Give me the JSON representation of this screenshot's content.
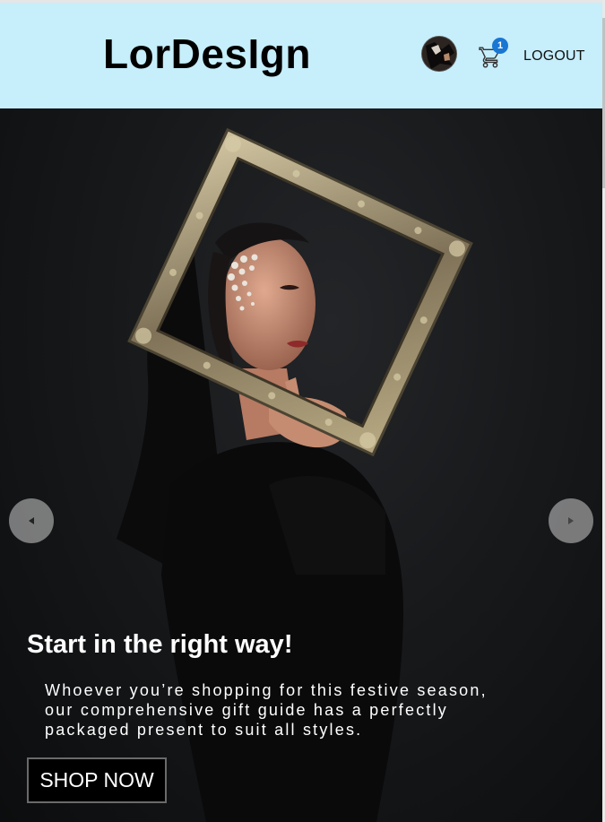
{
  "header": {
    "brand": "LorDesIgn",
    "avatar_icon": "user-avatar",
    "cart_icon": "shopping-cart-icon",
    "cart_count": "1",
    "logout_label": "LOGOUT"
  },
  "hero": {
    "title": "Start in the right way!",
    "description": "Whoever you’re shopping for this festive season, our comprehensive gift guide has a perfectly packaged present to suit all styles.",
    "cta_label": "SHOP NOW",
    "prev_icon": "arrow-left-icon",
    "next_icon": "arrow-right-icon"
  },
  "colors": {
    "header_bg": "#c6eefb",
    "badge": "#1976d2",
    "hero_bg": "#17191b"
  }
}
